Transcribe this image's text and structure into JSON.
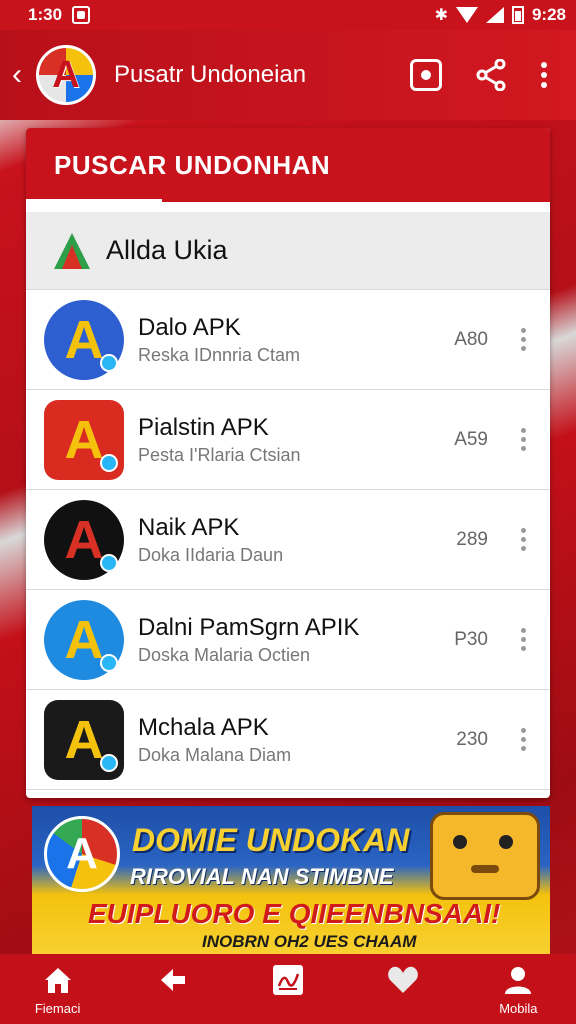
{
  "status_bar": {
    "time": "1:30",
    "clock": "9:28"
  },
  "app_bar": {
    "title": "Pusatr Undoneian"
  },
  "card": {
    "header": "PUSCAR UNDONHAN",
    "section_title": "Allda Ukia",
    "apps": [
      {
        "name": "Dalo APK",
        "desc": "Reska IDnnria Ctam",
        "size": "A80",
        "icon_bg": "#2d5fd0",
        "icon_fg": "#f4c20d",
        "icon_shape": "circle"
      },
      {
        "name": "Pialstin APK",
        "desc": "Pesta I'Rlaria Ctsian",
        "size": "A59",
        "icon_bg": "#d92b20",
        "icon_fg": "#f4c20d",
        "icon_shape": "rounded"
      },
      {
        "name": "Naik APK",
        "desc": "Doka IIdaria Daun",
        "size": "289",
        "icon_bg": "#111111",
        "icon_fg": "#d93025",
        "icon_shape": "circle"
      },
      {
        "name": "Dalni PamSgrn APIK",
        "desc": "Doska Malaria Octien",
        "size": "P30",
        "icon_bg": "#1f8be0",
        "icon_fg": "#f4c20d",
        "icon_shape": "circle"
      },
      {
        "name": "Mchala APK",
        "desc": "Doka Malana Diam",
        "size": "230",
        "icon_bg": "#1a1a1a",
        "icon_fg": "#f4c20d",
        "icon_shape": "rounded"
      }
    ]
  },
  "banner": {
    "headline": "DOMIE UNDOKAN",
    "sub": "RIROVIAL NAN STIMBNE",
    "promo": "EUIPLUORO E QIIEENBNSAAI!",
    "foot": "INOBRN OH2 UES CHAAM"
  },
  "bottom_nav": [
    {
      "label": "Fiemaci",
      "icon": "home-icon"
    },
    {
      "label": "",
      "icon": "back-arrow-icon"
    },
    {
      "label": "",
      "icon": "signature-icon"
    },
    {
      "label": "",
      "icon": "heart-icon"
    },
    {
      "label": "Mobila",
      "icon": "profile-icon"
    }
  ],
  "colors": {
    "brand_red": "#c8121c",
    "accent_yellow": "#f4c20d",
    "accent_blue": "#1a73e8"
  }
}
